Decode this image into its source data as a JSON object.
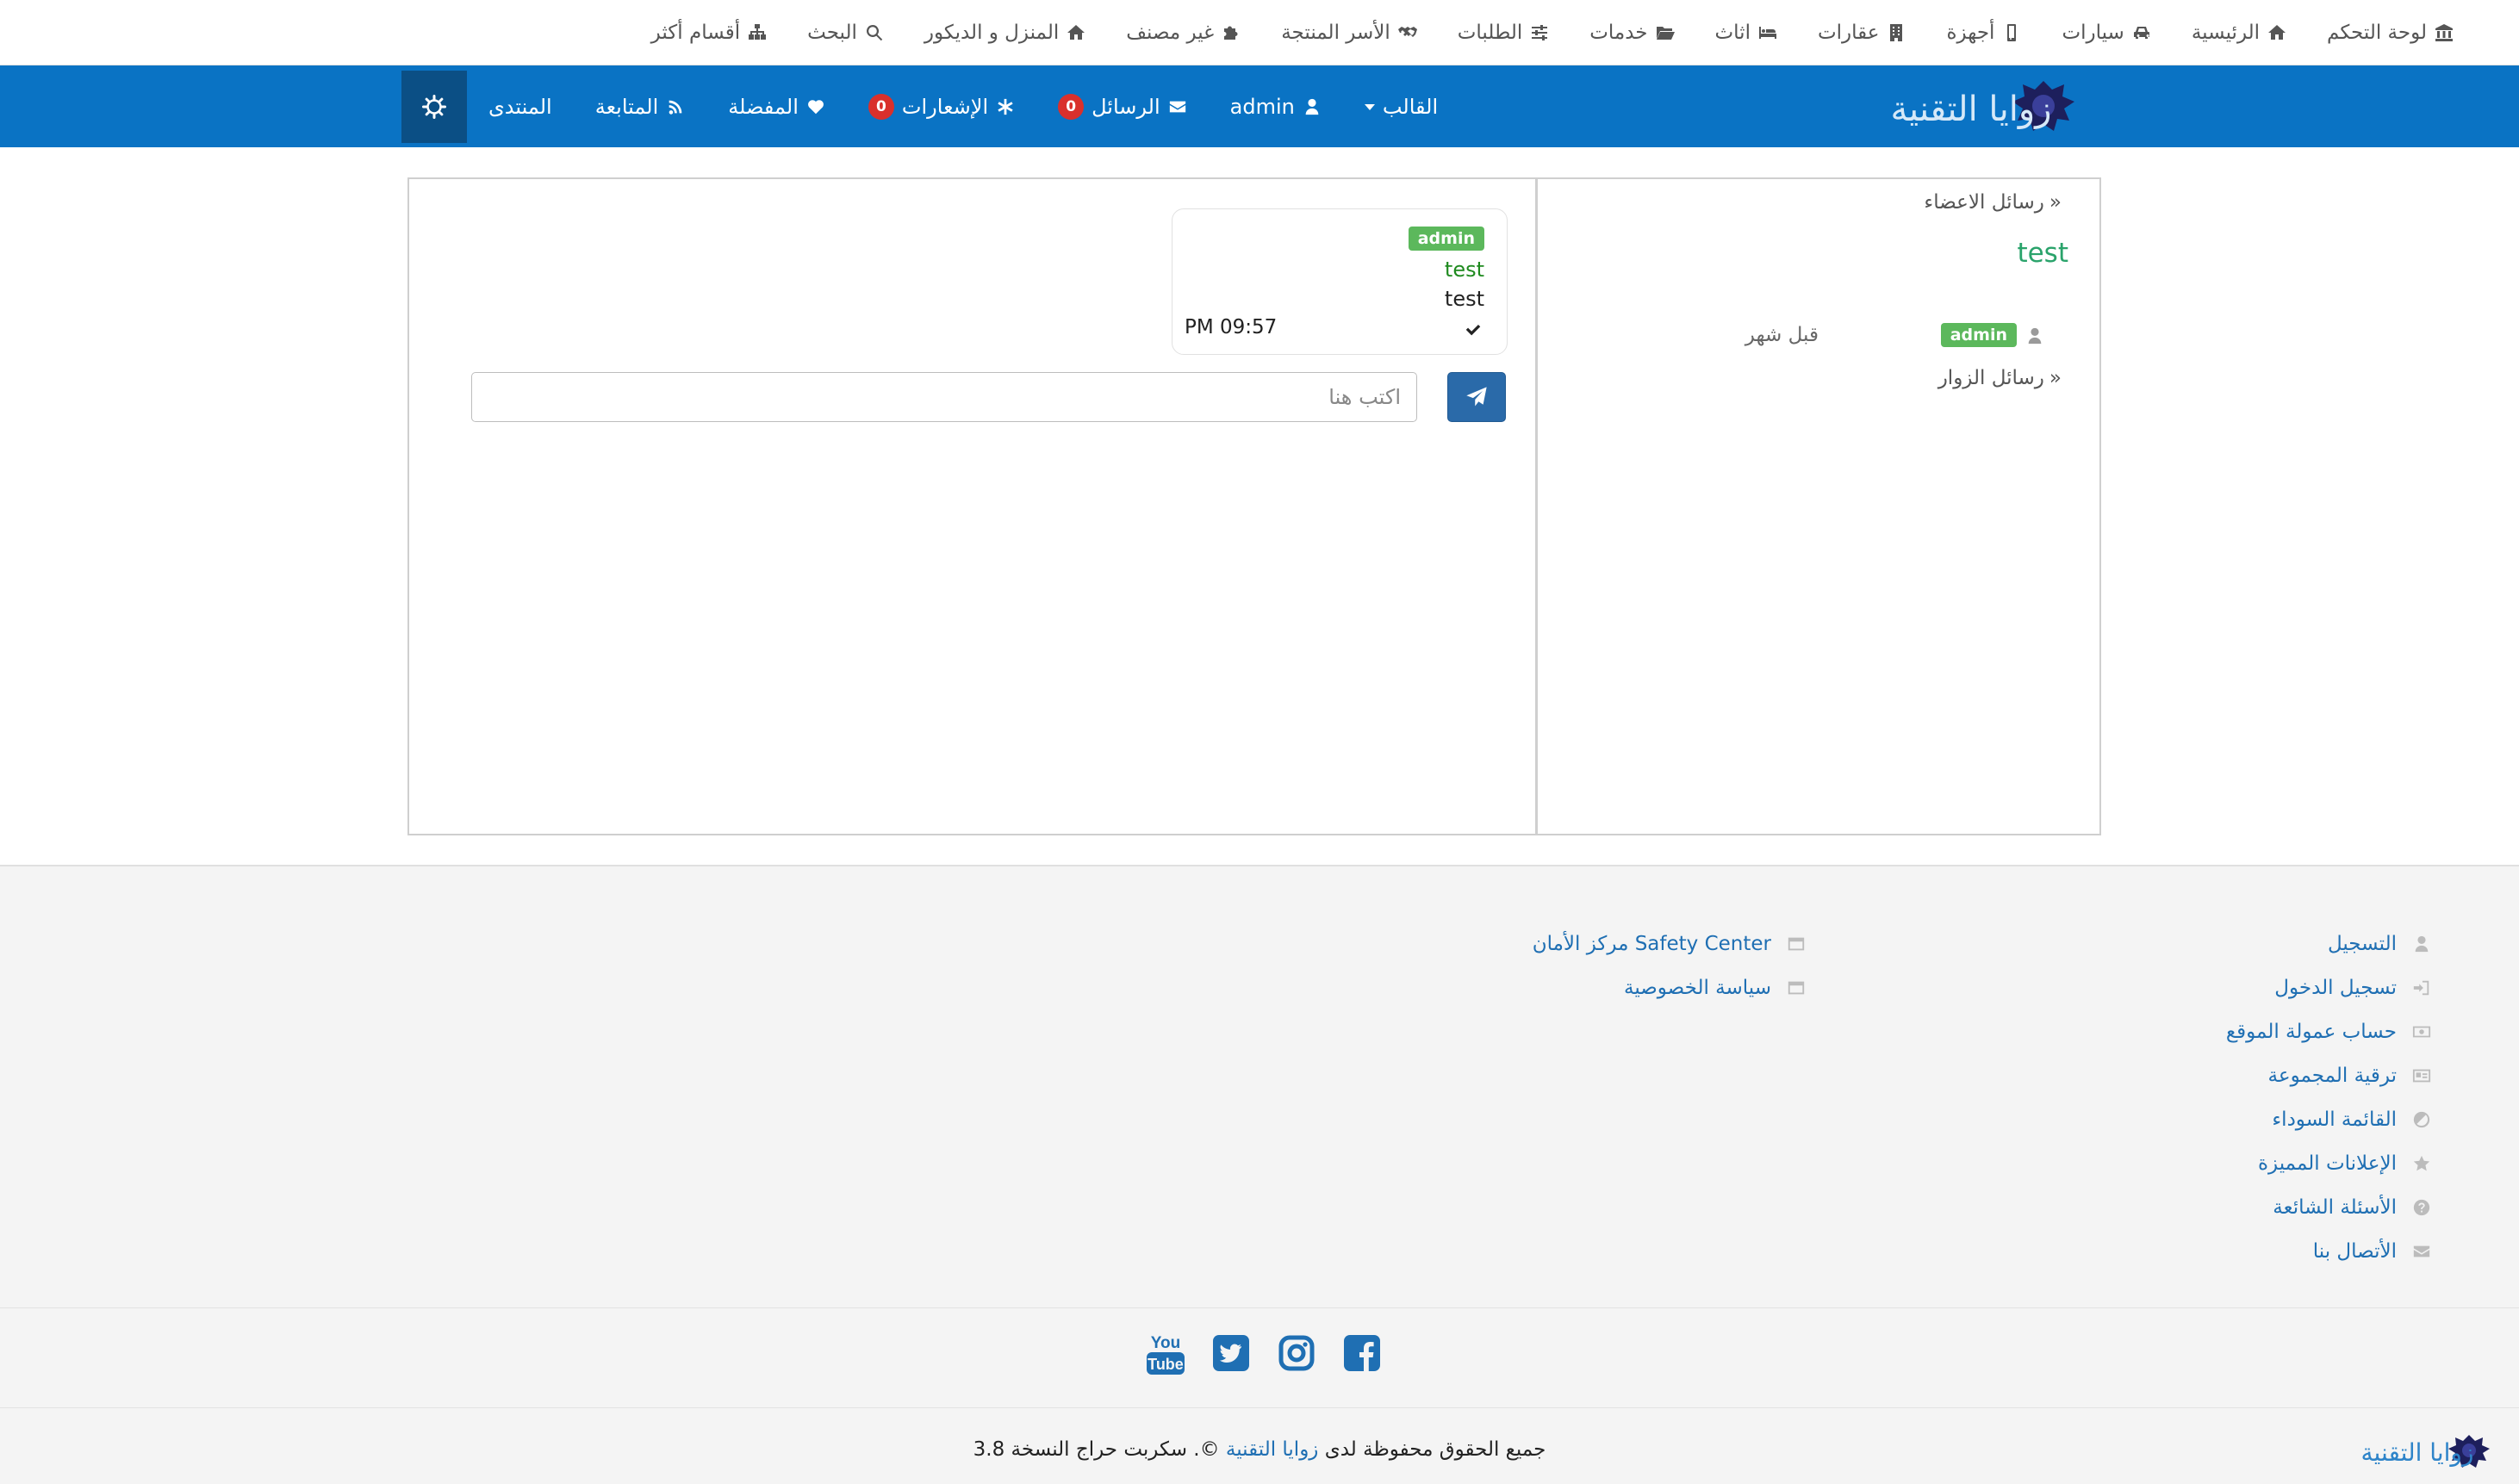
{
  "topnav": {
    "items": [
      {
        "label": "لوحة التحكم",
        "icon": "bank-icon"
      },
      {
        "label": "الرئيسية",
        "icon": "home-icon"
      },
      {
        "label": "سيارات",
        "icon": "car-icon"
      },
      {
        "label": "أجهزة",
        "icon": "mobile-icon"
      },
      {
        "label": "عقارات",
        "icon": "building-icon"
      },
      {
        "label": "اثاث",
        "icon": "bed-icon"
      },
      {
        "label": "خدمات",
        "icon": "folder-open-icon"
      },
      {
        "label": "الطلبات",
        "icon": "sliders-icon"
      },
      {
        "label": "الأسر المنتجة",
        "icon": "handshake-icon"
      },
      {
        "label": "غير مصنف",
        "icon": "puzzle-icon"
      },
      {
        "label": "المنزل و الديكور",
        "icon": "home-icon"
      },
      {
        "label": "البحث",
        "icon": "search-icon"
      },
      {
        "label": "أقسام أكثر",
        "icon": "sitemap-icon"
      }
    ]
  },
  "navbar": {
    "logo_text": "زوايا التقنية",
    "theme_label": "القالب",
    "user_label": "admin",
    "messages_label": "الرسائل",
    "messages_count": "0",
    "notifications_label": "الإشعارات",
    "notifications_count": "0",
    "favorites_label": "المفضلة",
    "following_label": "المتابعة",
    "forum_label": "المنتدى"
  },
  "conversation": {
    "message": {
      "sender_badge": "admin",
      "subject": "test",
      "text": "test",
      "time": "PM 09:57"
    },
    "input_placeholder": "اكتب هنا"
  },
  "sidebar": {
    "members_messages": "رسائل الاعضاء",
    "conversation_title": "test",
    "conversation_user_badge": "admin",
    "conversation_time": "قبل شهر",
    "visitors_messages": "رسائل الزوار"
  },
  "footer": {
    "links_col1": [
      {
        "label": "التسجيل",
        "icon": "user-icon"
      },
      {
        "label": "تسجيل الدخول",
        "icon": "sign-in-icon"
      },
      {
        "label": "حساب عمولة الموقع",
        "icon": "money-icon"
      },
      {
        "label": "ترقية المجموعة",
        "icon": "id-card-icon"
      },
      {
        "label": "القائمة السوداء",
        "icon": "ban-icon"
      },
      {
        "label": "الإعلانات المميزة",
        "icon": "star-icon"
      },
      {
        "label": "الأسئلة الشائعة",
        "icon": "question-icon"
      },
      {
        "label": "الأتصال بنا",
        "icon": "envelope-icon"
      }
    ],
    "links_col2": [
      {
        "label": "مركز الأمان Safety Center",
        "icon": "window-icon"
      },
      {
        "label": "سياسة الخصوصية",
        "icon": "window-icon"
      }
    ],
    "social": [
      "facebook-icon",
      "instagram-icon",
      "twitter-icon",
      "youtube-icon"
    ],
    "youtube_you": "You",
    "youtube_tube": "Tube",
    "copyright_prefix": "جميع الحقوق محفوظة لدى",
    "copyright_link": "زوايا التقنية",
    "copyright_suffix": "©. سكربت حراج النسخة 3.8",
    "logo_text": "زوايا التقنية"
  },
  "colors": {
    "navbar": "#0a73c4",
    "navbar_dark": "#0b4f85",
    "badge_red": "#d9302c",
    "badge_green": "#5cb85c",
    "link_blue": "#1f6fb3",
    "title_green": "#2aa36b",
    "send_button": "#2a6aa9"
  }
}
